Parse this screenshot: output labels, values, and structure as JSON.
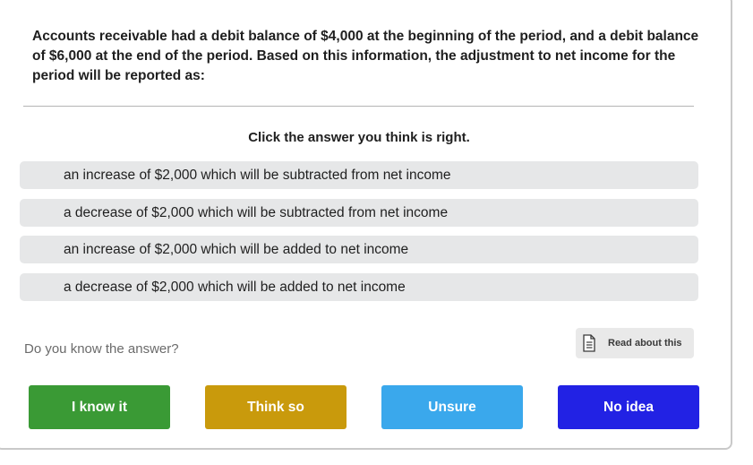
{
  "question": {
    "text": "Accounts receivable had a debit balance of $4,000 at the beginning of the period, and a debit balance of $6,000 at the end of the period. Based on this information, the adjustment to net income for the period will be reported as:"
  },
  "prompt": "Click the answer you think is right.",
  "answers": [
    {
      "label": "an increase of $2,000 which will be subtracted from net income"
    },
    {
      "label": "a decrease of $2,000 which will be subtracted from net income"
    },
    {
      "label": "an increase of $2,000 which will be added to net income"
    },
    {
      "label": "a decrease of $2,000 which will be added to net income"
    }
  ],
  "confidence": {
    "question_label": "Do you know the answer?",
    "read_about_label": "Read about this",
    "read_about_icon": "document-icon",
    "buttons": [
      {
        "label": "I know it",
        "color": "#3a9a35"
      },
      {
        "label": "Think so",
        "color": "#c99a0c"
      },
      {
        "label": "Unsure",
        "color": "#3aa8ec"
      },
      {
        "label": "No idea",
        "color": "#2222e4"
      }
    ]
  }
}
